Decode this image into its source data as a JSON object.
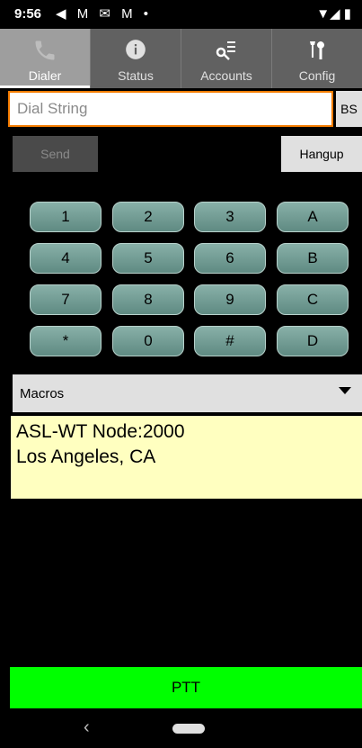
{
  "status_bar": {
    "time": "9:56",
    "icons_left": "◀ M ✉ M •",
    "icons_right": "▼◢ ▮"
  },
  "tabs": [
    {
      "label": "Dialer",
      "icon": "phone-icon",
      "active": true
    },
    {
      "label": "Status",
      "icon": "info-icon",
      "active": false
    },
    {
      "label": "Accounts",
      "icon": "key-list-icon",
      "active": false
    },
    {
      "label": "Config",
      "icon": "tools-icon",
      "active": false
    }
  ],
  "dial": {
    "placeholder": "Dial String",
    "value": "",
    "bs_label": "BS"
  },
  "actions": {
    "send_label": "Send",
    "hangup_label": "Hangup"
  },
  "keypad": [
    [
      "1",
      "2",
      "3",
      "A"
    ],
    [
      "4",
      "5",
      "6",
      "B"
    ],
    [
      "7",
      "8",
      "9",
      "C"
    ],
    [
      "*",
      "0",
      "#",
      "D"
    ]
  ],
  "macros": {
    "selected": "Macros"
  },
  "info": {
    "line1": "ASL-WT Node:2000",
    "line2": "Los Angeles, CA"
  },
  "ptt": {
    "label": "PTT"
  },
  "colors": {
    "accent_orange": "#f57c00",
    "ptt_green": "#00ff00",
    "key_teal": "#6f9a92",
    "info_bg": "#ffffc0"
  }
}
